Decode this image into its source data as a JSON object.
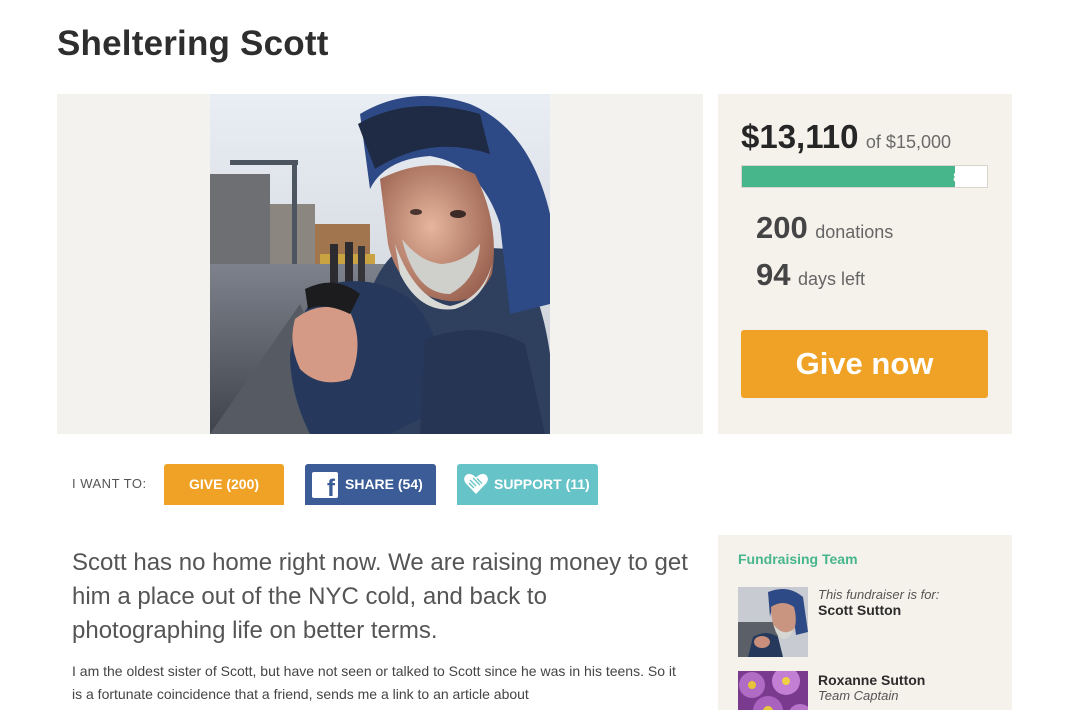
{
  "campaign": {
    "title": "Sheltering Scott"
  },
  "stats": {
    "raised": "$13,110",
    "goal_text": "of $15,000",
    "progress_fraction": 0.87,
    "progress_label": "87%",
    "donations_count": "200",
    "donations_label": "donations",
    "days_count": "94",
    "days_label": "days left",
    "give_now_label": "Give now"
  },
  "actions": {
    "prompt": "I WANT TO:",
    "give_label": "GIVE (200)",
    "share_label": "SHARE (54)",
    "support_label": "SUPPORT (11)"
  },
  "story": {
    "lead": "Scott has no home right now. We are raising money to get him a place out of the NYC cold, and back to photographing life on better terms.",
    "body": "I am the oldest sister of Scott, but have not seen or talked to Scott since he was in his teens. So it is a fortunate coincidence that a friend, sends me a link to an article about"
  },
  "team": {
    "title": "Fundraising Team",
    "members": [
      {
        "note": "This fundraiser is for:",
        "name": "Scott Sutton",
        "role": ""
      },
      {
        "note": "",
        "name": "Roxanne Sutton",
        "role": "Team Captain"
      }
    ]
  },
  "colors": {
    "accent_orange": "#efa225",
    "accent_green": "#47b68a",
    "facebook_blue": "#3b5c97",
    "support_teal": "#66c3c7"
  },
  "icons": [
    "facebook-icon",
    "heart-icon"
  ]
}
